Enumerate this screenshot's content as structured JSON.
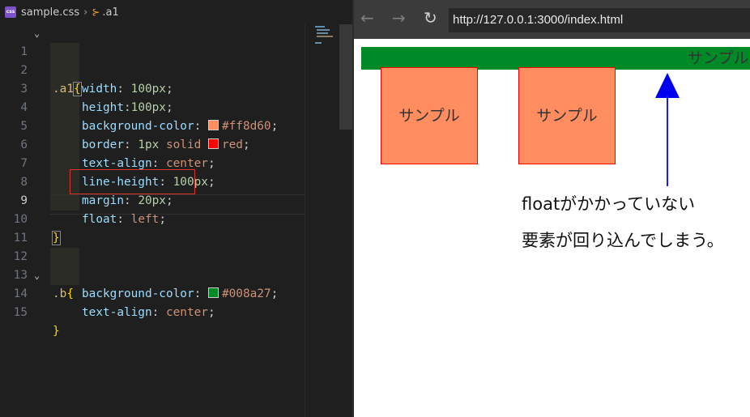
{
  "editor": {
    "filename": "sample.css",
    "file_badge": "css",
    "symbol": ".a1",
    "lines": [
      {
        "n": "1"
      },
      {
        "n": "2"
      },
      {
        "n": "3"
      },
      {
        "n": "4"
      },
      {
        "n": "5"
      },
      {
        "n": "6"
      },
      {
        "n": "7"
      },
      {
        "n": "8"
      },
      {
        "n": "9"
      },
      {
        "n": "10"
      },
      {
        "n": "11"
      },
      {
        "n": "12"
      },
      {
        "n": "13"
      },
      {
        "n": "14"
      },
      {
        "n": "15"
      }
    ],
    "code": {
      "l1_sel": ".a1",
      "l1_brace": "{",
      "l2_prop": "width",
      "l2_val": "100px",
      "l3_prop": "height",
      "l3_val": "100px",
      "l4_prop": "background-color",
      "l4_val": "#ff8d60",
      "l4_color": "#ff8d60",
      "l5_prop": "border",
      "l5_num": "1px",
      "l5_kw": "solid",
      "l5_val": "red",
      "l5_color": "#ff0000",
      "l6_prop": "text-align",
      "l6_val": "center",
      "l7_prop": "line-height",
      "l7_val": "100px",
      "l8_prop": "margin",
      "l8_val": "20px",
      "l9_prop": "float",
      "l9_val": "left",
      "l10_brace": "}",
      "l12_sel": ".b",
      "l12_brace": "{",
      "l13_prop": "background-color",
      "l13_val": "#008a27",
      "l13_color": "#008a27",
      "l14_prop": "text-align",
      "l14_val": "center",
      "l15_brace": "}"
    }
  },
  "browser": {
    "back_icon": "arrow-left-icon",
    "forward_icon": "arrow-right-icon",
    "reload_icon": "reload-icon",
    "url": "http://127.0.0.1:3000/index.html",
    "green_text": "サンプル",
    "box1_text": "サンプル",
    "box2_text": "サンプル",
    "note_line1": "floatがかかっていない",
    "note_line2": "要素が回り込んでしまう。",
    "colors": {
      "green": "#008a27",
      "orange": "#ff8d60",
      "border": "#ff0000",
      "arrow": "#0000ee"
    }
  }
}
